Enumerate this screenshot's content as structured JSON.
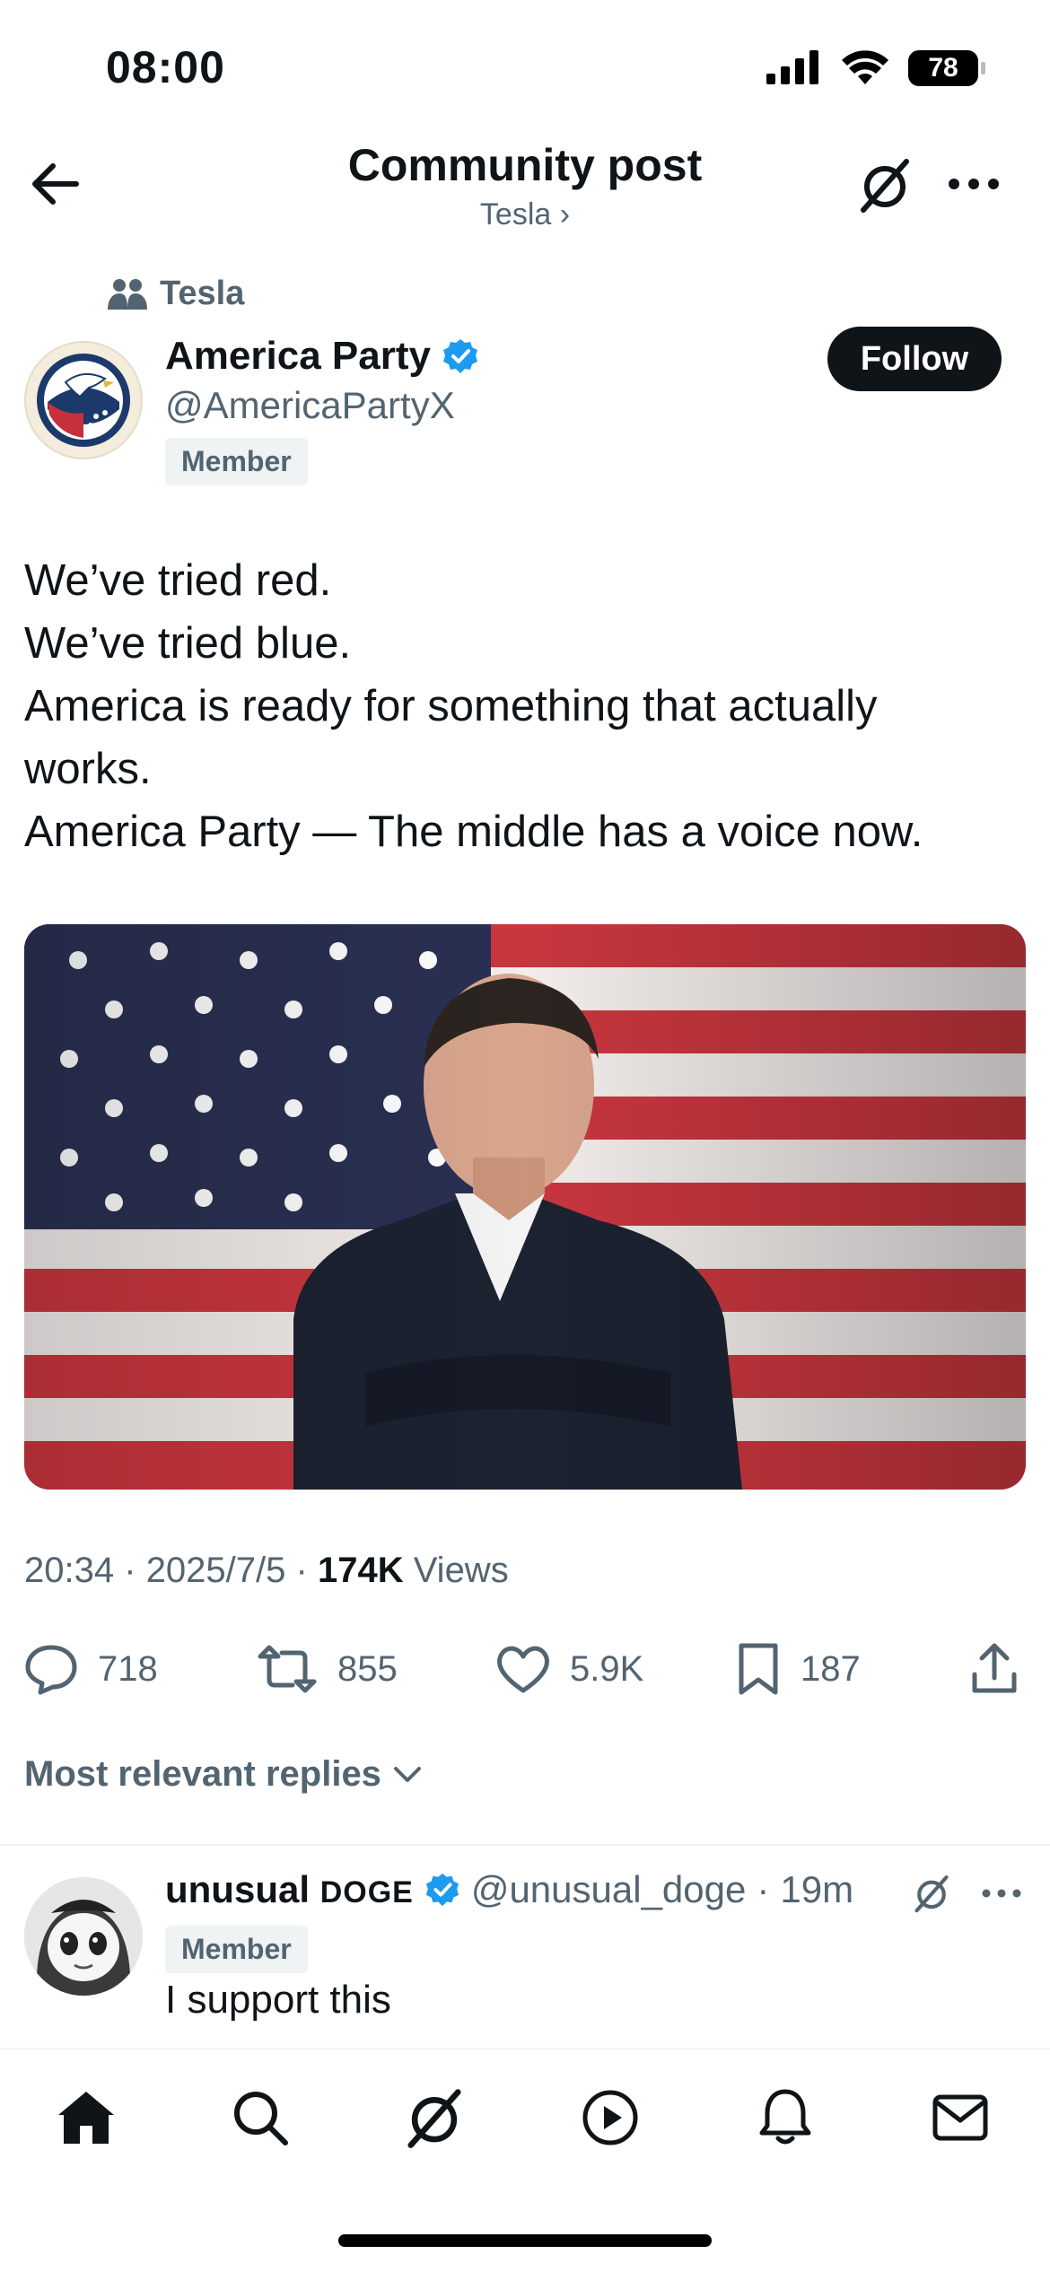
{
  "status_bar": {
    "time": "08:00",
    "battery": "78"
  },
  "header": {
    "title": "Community post",
    "subtitle": "Tesla ›",
    "back_icon": "arrow-left-icon",
    "grok_icon": "grok-icon",
    "more_icon": "more-horizontal-icon"
  },
  "post": {
    "community": "Tesla",
    "author": {
      "name": "America Party",
      "handle": "@AmericaPartyX",
      "badge": "Member",
      "verified": true
    },
    "follow_label": "Follow",
    "text_lines": [
      "We’ve tried red.",
      "We’ve tried blue.",
      "America is ready for something that actually",
      "works.",
      "America Party — The middle has a voice now."
    ],
    "meta": {
      "time": "20:34",
      "date": "2025/7/5",
      "views_count": "174K",
      "views_label": "Views",
      "separator": "·"
    },
    "actions": {
      "replies": "718",
      "reposts": "855",
      "likes": "5.9K",
      "bookmarks": "187"
    }
  },
  "replies_sort": "Most relevant replies",
  "reply": {
    "name_main": "unusual",
    "name_small": "DOGE",
    "handle": "@unusual_doge",
    "separator": "·",
    "time": "19m",
    "badge": "Member",
    "text": "I support this"
  },
  "tabbar": [
    "home-icon",
    "search-icon",
    "grok-icon",
    "play-icon",
    "bell-icon",
    "mail-icon"
  ],
  "colors": {
    "text": "#0f1419",
    "secondary": "#536471",
    "verified": "#1d9bf0",
    "button": "#0f1419"
  }
}
